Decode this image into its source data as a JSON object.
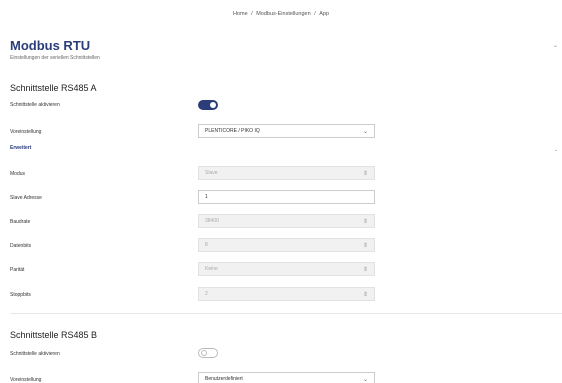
{
  "breadcrumb": {
    "items": [
      "Home",
      "Modbus-Einstellungen",
      "App"
    ],
    "separator": "/"
  },
  "header": {
    "title": "Modbus RTU",
    "subtitle": "Einstellungen der seriellen Schnittstellen",
    "collapse_icon": "chevron-down-icon"
  },
  "interface_a": {
    "title": "Schnittstelle RS485 A",
    "enable_label": "Schnittstelle aktivieren",
    "enabled": true,
    "preset_label": "Voreinstellung",
    "preset_value": "PLENTICORE / PIKO IQ",
    "advanced_label": "Erweitert",
    "fields": {
      "mode": {
        "label": "Modus",
        "value": "Slave"
      },
      "slave_address": {
        "label": "Slave Adresse",
        "value": "1"
      },
      "baudrate": {
        "label": "Baudrate",
        "value": "38400"
      },
      "databits": {
        "label": "Datenbits",
        "value": "8"
      },
      "parity": {
        "label": "Parität",
        "value": "Keine"
      },
      "stopbits": {
        "label": "Stoppbits",
        "value": "2"
      }
    }
  },
  "interface_b": {
    "title": "Schnittstelle RS485 B",
    "enable_label": "Schnittstelle aktivieren",
    "enabled": false,
    "preset_label": "Voreinstellung",
    "preset_value": "Benutzerdefiniert"
  },
  "colors": {
    "accent": "#2c3e7a",
    "disabled_bg": "#f1f1f1",
    "border": "#cccccc"
  }
}
